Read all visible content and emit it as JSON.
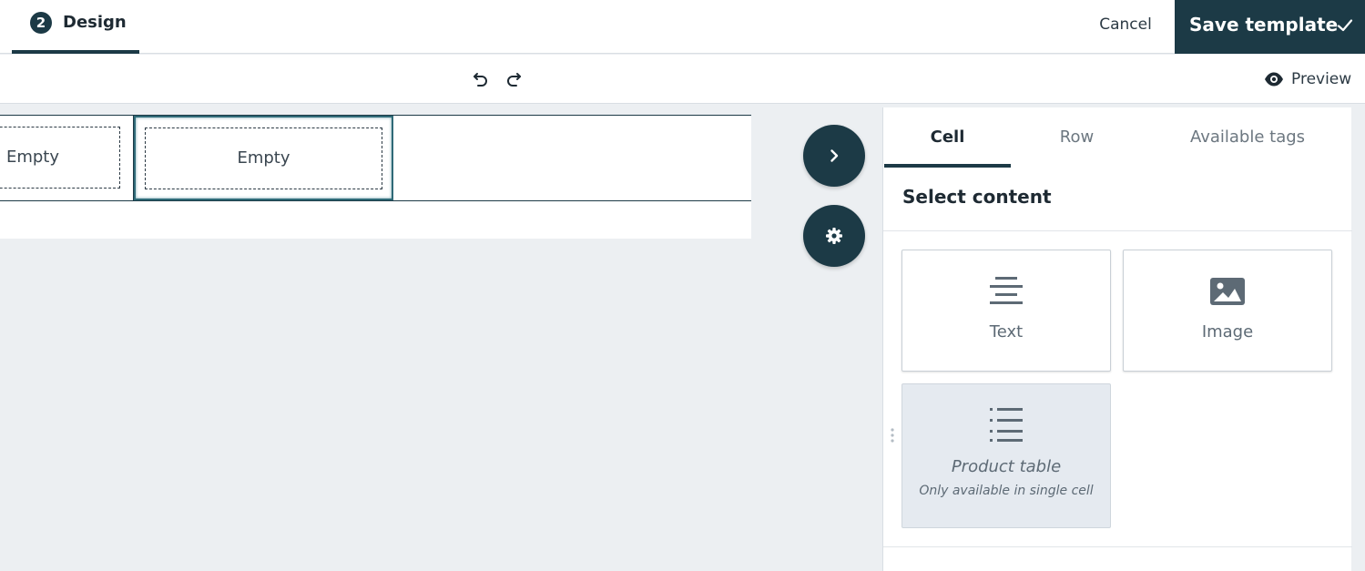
{
  "header": {
    "step_number": "2",
    "step_label": "Design",
    "cancel_label": "Cancel",
    "save_label": "Save template"
  },
  "toolbar": {
    "preview_label": "Preview"
  },
  "canvas": {
    "cells": [
      {
        "label": "Empty"
      },
      {
        "label": "Empty"
      }
    ]
  },
  "panel": {
    "tabs": [
      {
        "label": "Cell",
        "active": true
      },
      {
        "label": "Row",
        "active": false
      },
      {
        "label": "Available tags",
        "active": false
      }
    ],
    "title": "Select content",
    "cards": [
      {
        "label": "Text",
        "icon": "text-align-icon",
        "disabled": false
      },
      {
        "label": "Image",
        "icon": "image-icon",
        "disabled": false
      },
      {
        "label": "Product table",
        "sub": "Only available in single cell",
        "icon": "list-icon",
        "disabled": true
      }
    ]
  },
  "colors": {
    "primary": "#1c3a46",
    "canvas_bg": "#eceff2",
    "disabled_card_bg": "#e5eaf0"
  }
}
